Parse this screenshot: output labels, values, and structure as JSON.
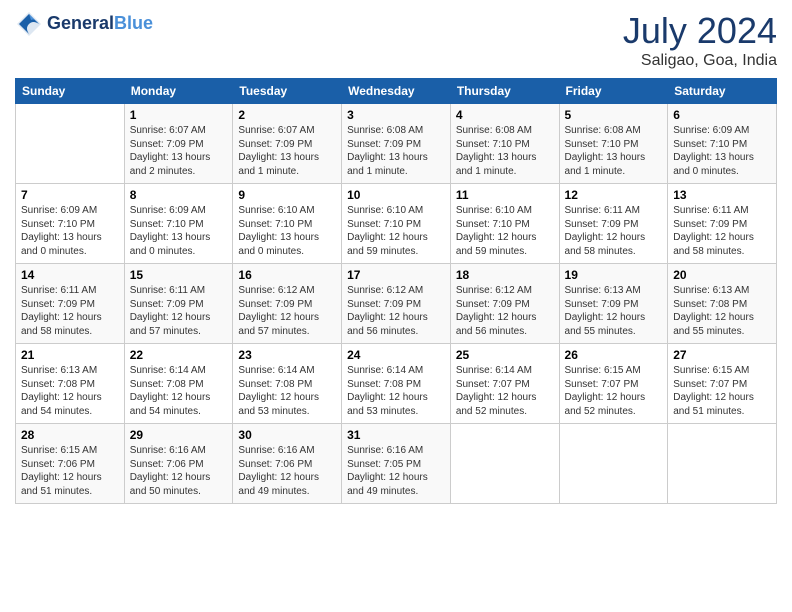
{
  "header": {
    "logo_line1": "General",
    "logo_line2": "Blue",
    "month": "July 2024",
    "location": "Saligao, Goa, India"
  },
  "columns": [
    "Sunday",
    "Monday",
    "Tuesday",
    "Wednesday",
    "Thursday",
    "Friday",
    "Saturday"
  ],
  "weeks": [
    [
      {
        "day": "",
        "info": ""
      },
      {
        "day": "1",
        "info": "Sunrise: 6:07 AM\nSunset: 7:09 PM\nDaylight: 13 hours\nand 2 minutes."
      },
      {
        "day": "2",
        "info": "Sunrise: 6:07 AM\nSunset: 7:09 PM\nDaylight: 13 hours\nand 1 minute."
      },
      {
        "day": "3",
        "info": "Sunrise: 6:08 AM\nSunset: 7:09 PM\nDaylight: 13 hours\nand 1 minute."
      },
      {
        "day": "4",
        "info": "Sunrise: 6:08 AM\nSunset: 7:10 PM\nDaylight: 13 hours\nand 1 minute."
      },
      {
        "day": "5",
        "info": "Sunrise: 6:08 AM\nSunset: 7:10 PM\nDaylight: 13 hours\nand 1 minute."
      },
      {
        "day": "6",
        "info": "Sunrise: 6:09 AM\nSunset: 7:10 PM\nDaylight: 13 hours\nand 0 minutes."
      }
    ],
    [
      {
        "day": "7",
        "info": "Sunrise: 6:09 AM\nSunset: 7:10 PM\nDaylight: 13 hours\nand 0 minutes."
      },
      {
        "day": "8",
        "info": "Sunrise: 6:09 AM\nSunset: 7:10 PM\nDaylight: 13 hours\nand 0 minutes."
      },
      {
        "day": "9",
        "info": "Sunrise: 6:10 AM\nSunset: 7:10 PM\nDaylight: 13 hours\nand 0 minutes."
      },
      {
        "day": "10",
        "info": "Sunrise: 6:10 AM\nSunset: 7:10 PM\nDaylight: 12 hours\nand 59 minutes."
      },
      {
        "day": "11",
        "info": "Sunrise: 6:10 AM\nSunset: 7:10 PM\nDaylight: 12 hours\nand 59 minutes."
      },
      {
        "day": "12",
        "info": "Sunrise: 6:11 AM\nSunset: 7:09 PM\nDaylight: 12 hours\nand 58 minutes."
      },
      {
        "day": "13",
        "info": "Sunrise: 6:11 AM\nSunset: 7:09 PM\nDaylight: 12 hours\nand 58 minutes."
      }
    ],
    [
      {
        "day": "14",
        "info": "Sunrise: 6:11 AM\nSunset: 7:09 PM\nDaylight: 12 hours\nand 58 minutes."
      },
      {
        "day": "15",
        "info": "Sunrise: 6:11 AM\nSunset: 7:09 PM\nDaylight: 12 hours\nand 57 minutes."
      },
      {
        "day": "16",
        "info": "Sunrise: 6:12 AM\nSunset: 7:09 PM\nDaylight: 12 hours\nand 57 minutes."
      },
      {
        "day": "17",
        "info": "Sunrise: 6:12 AM\nSunset: 7:09 PM\nDaylight: 12 hours\nand 56 minutes."
      },
      {
        "day": "18",
        "info": "Sunrise: 6:12 AM\nSunset: 7:09 PM\nDaylight: 12 hours\nand 56 minutes."
      },
      {
        "day": "19",
        "info": "Sunrise: 6:13 AM\nSunset: 7:09 PM\nDaylight: 12 hours\nand 55 minutes."
      },
      {
        "day": "20",
        "info": "Sunrise: 6:13 AM\nSunset: 7:08 PM\nDaylight: 12 hours\nand 55 minutes."
      }
    ],
    [
      {
        "day": "21",
        "info": "Sunrise: 6:13 AM\nSunset: 7:08 PM\nDaylight: 12 hours\nand 54 minutes."
      },
      {
        "day": "22",
        "info": "Sunrise: 6:14 AM\nSunset: 7:08 PM\nDaylight: 12 hours\nand 54 minutes."
      },
      {
        "day": "23",
        "info": "Sunrise: 6:14 AM\nSunset: 7:08 PM\nDaylight: 12 hours\nand 53 minutes."
      },
      {
        "day": "24",
        "info": "Sunrise: 6:14 AM\nSunset: 7:08 PM\nDaylight: 12 hours\nand 53 minutes."
      },
      {
        "day": "25",
        "info": "Sunrise: 6:14 AM\nSunset: 7:07 PM\nDaylight: 12 hours\nand 52 minutes."
      },
      {
        "day": "26",
        "info": "Sunrise: 6:15 AM\nSunset: 7:07 PM\nDaylight: 12 hours\nand 52 minutes."
      },
      {
        "day": "27",
        "info": "Sunrise: 6:15 AM\nSunset: 7:07 PM\nDaylight: 12 hours\nand 51 minutes."
      }
    ],
    [
      {
        "day": "28",
        "info": "Sunrise: 6:15 AM\nSunset: 7:06 PM\nDaylight: 12 hours\nand 51 minutes."
      },
      {
        "day": "29",
        "info": "Sunrise: 6:16 AM\nSunset: 7:06 PM\nDaylight: 12 hours\nand 50 minutes."
      },
      {
        "day": "30",
        "info": "Sunrise: 6:16 AM\nSunset: 7:06 PM\nDaylight: 12 hours\nand 49 minutes."
      },
      {
        "day": "31",
        "info": "Sunrise: 6:16 AM\nSunset: 7:05 PM\nDaylight: 12 hours\nand 49 minutes."
      },
      {
        "day": "",
        "info": ""
      },
      {
        "day": "",
        "info": ""
      },
      {
        "day": "",
        "info": ""
      }
    ]
  ]
}
